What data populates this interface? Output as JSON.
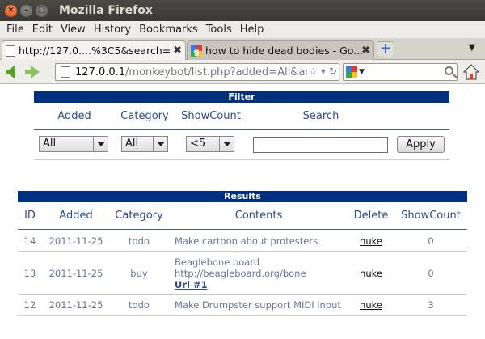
{
  "window": {
    "title": "Mozilla Firefox"
  },
  "menu": [
    "File",
    "Edit",
    "View",
    "History",
    "Bookmarks",
    "Tools",
    "Help"
  ],
  "tabs": [
    {
      "label": "http://127.0....%3C5&search=",
      "active": true
    },
    {
      "label": "how to hide dead bodies - Go...",
      "active": false
    }
  ],
  "nav": {
    "url_host": "127.0.0.1",
    "url_path": "/monkeybot/list.php?added=All&ad"
  },
  "filter": {
    "title": "Filter",
    "headers": {
      "added": "Added",
      "category": "Category",
      "showcount": "ShowCount",
      "search": "Search"
    },
    "added_value": "All",
    "category_value": "All",
    "showcount_value": "<5",
    "search_value": "",
    "apply_label": "Apply"
  },
  "results": {
    "title": "Results",
    "headers": {
      "id": "ID",
      "added": "Added",
      "category": "Category",
      "contents": "Contents",
      "delete": "Delete",
      "showcount": "ShowCount"
    },
    "rows": [
      {
        "id": "14",
        "added": "2011-11-25",
        "category": "todo",
        "contents": [
          "Make cartoon about protesters."
        ],
        "link": "",
        "delete": "nuke",
        "showcount": "0"
      },
      {
        "id": "13",
        "added": "2011-11-25",
        "category": "buy",
        "contents": [
          "Beaglebone board",
          "http://beagleboard.org/bone"
        ],
        "link": "Url #1",
        "delete": "nuke",
        "showcount": "0"
      },
      {
        "id": "12",
        "added": "2011-11-25",
        "category": "todo",
        "contents": [
          "Make Drumpster support MIDI input"
        ],
        "link": "",
        "delete": "nuke",
        "showcount": "3"
      }
    ]
  },
  "colors": {
    "band": "#003080",
    "header_text": "#2c4a8c",
    "cell_text": "#6a7593",
    "titlebar": "#3c3b37",
    "close_button": "#e2571e"
  }
}
